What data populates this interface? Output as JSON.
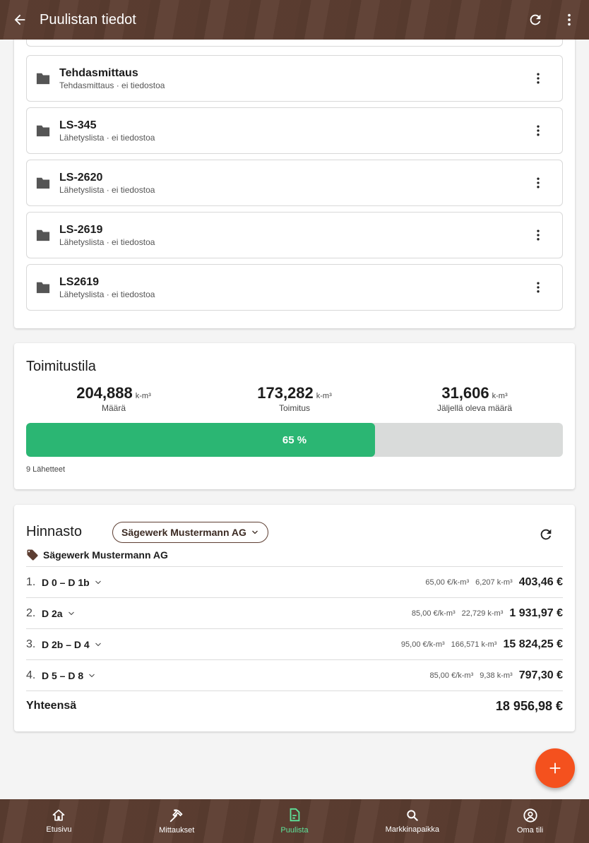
{
  "appbar": {
    "title": "Puulistan tiedot",
    "back_icon": "arrow-back-icon",
    "refresh_icon": "refresh-icon",
    "more_icon": "more-vert-icon"
  },
  "documents": [
    {
      "name": "Tehdasmittaus",
      "sub": "Tehdasmittaus · ei tiedostoa"
    },
    {
      "name": "LS-345",
      "sub": "Lähetyslista · ei tiedostoa"
    },
    {
      "name": "LS-2620",
      "sub": "Lähetyslista · ei tiedostoa"
    },
    {
      "name": "LS-2619",
      "sub": "Lähetyslista · ei tiedostoa"
    },
    {
      "name": "LS2619",
      "sub": "Lähetyslista · ei tiedostoa"
    }
  ],
  "delivery": {
    "title": "Toimitustila",
    "stats": [
      {
        "value": "204,888",
        "unit": "k-m³",
        "label": "Määrä"
      },
      {
        "value": "173,282",
        "unit": "k-m³",
        "label": "Toimitus"
      },
      {
        "value": "31,606",
        "unit": "k-m³",
        "label": "Jäljellä oleva määrä"
      }
    ],
    "progress_percent": 65,
    "progress_label": "65 %",
    "shipments": "9 Lähetteet"
  },
  "pricelist": {
    "title": "Hinnasto",
    "selected_buyer": "Sägewerk Mustermann AG",
    "buyer_label": "Sägewerk Mustermann AG",
    "rows": [
      {
        "num": "1.",
        "class": "D 0 – D 1b",
        "unit_price": "65,00 €/k-m³",
        "qty": "6,207 k-m³",
        "sum": "403,46 €"
      },
      {
        "num": "2.",
        "class": "D 2a",
        "unit_price": "85,00 €/k-m³",
        "qty": "22,729 k-m³",
        "sum": "1 931,97 €"
      },
      {
        "num": "3.",
        "class": "D 2b – D 4",
        "unit_price": "95,00 €/k-m³",
        "qty": "166,571 k-m³",
        "sum": "15 824,25 €"
      },
      {
        "num": "4.",
        "class": "D 5 – D 8",
        "unit_price": "85,00 €/k-m³",
        "qty": "9,38 k-m³",
        "sum": "797,30 €"
      }
    ],
    "total_label": "Yhteensä",
    "total": "18 956,98 €"
  },
  "nav": [
    {
      "label": "Etusivu",
      "icon": "home-icon",
      "active": false
    },
    {
      "label": "Mittaukset",
      "icon": "hammer-pick-icon",
      "active": false
    },
    {
      "label": "Puulista",
      "icon": "document-list-icon",
      "active": true
    },
    {
      "label": "Markkinapaikka",
      "icon": "search-icon",
      "active": false
    },
    {
      "label": "Oma tili",
      "icon": "account-icon",
      "active": false
    }
  ],
  "colors": {
    "brand": "#5d3e32",
    "progress": "#2bb673",
    "fab": "#f4511e",
    "nav_active": "#5ee39a"
  }
}
